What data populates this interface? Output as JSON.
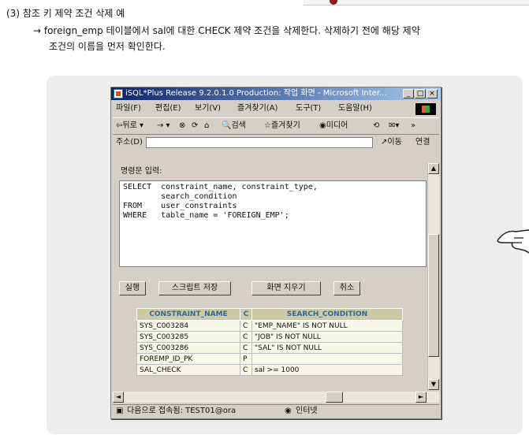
{
  "doc": {
    "heading": "(3) 참조 키 제약 조건 삭제 예",
    "line1": "→ foreign_emp 테이블에서 sal에 대한 CHECK 제약 조건을 삭제한다. 삭제하기 전에 해당 제약",
    "line2": "조건의 이름을 먼저 확인한다."
  },
  "window": {
    "title": "iSQL*Plus Release 9.2.0.1.0 Production: 작업 화면 - Microsoft Inter...",
    "menu": [
      "파일(F)",
      "편집(E)",
      "보기(V)",
      "즐겨찾기(A)",
      "도구(T)",
      "도움말(H)"
    ],
    "toolbar": {
      "back": "뒤로",
      "search": "검색",
      "favorites": "즐겨찾기",
      "media": "미디어"
    },
    "address_label": "주소(D)",
    "go_label": "이동",
    "links_label": "연결"
  },
  "sql": {
    "label": "명령문 입력:",
    "lines": [
      "SELECT  constraint_name, constraint_type,",
      "        search_condition",
      "FROM    user_constraints",
      "WHERE   table_name = 'FOREIGN_EMP';"
    ]
  },
  "buttons": {
    "execute": "실행",
    "save_script": "스크립트 저장",
    "clear_screen": "화면 지우기",
    "cancel": "취소"
  },
  "results": {
    "headers": [
      "CONSTRAINT_NAME",
      "C",
      "SEARCH_CONDITION"
    ],
    "rows": [
      [
        "SYS_C003284",
        "C",
        "\"EMP_NAME\" IS NOT NULL"
      ],
      [
        "SYS_C003285",
        "C",
        "\"JOB\" IS NOT NULL"
      ],
      [
        "SYS_C003286",
        "C",
        "\"SAL\" IS NOT NULL"
      ],
      [
        "FOREMP_ID_PK",
        "P",
        ""
      ],
      [
        "SAL_CHECK",
        "C",
        "sal >= 1000"
      ]
    ]
  },
  "status": {
    "connected": "다음으로 접속됨: TEST01@ora",
    "zone": "인터넷"
  },
  "colors": {
    "titlebar_start": "#0a246a",
    "titlebar_end": "#a6caf0",
    "table_header_bg": "#ccc9a6",
    "table_header_text": "#336699",
    "panel_bg": "#ededed"
  }
}
